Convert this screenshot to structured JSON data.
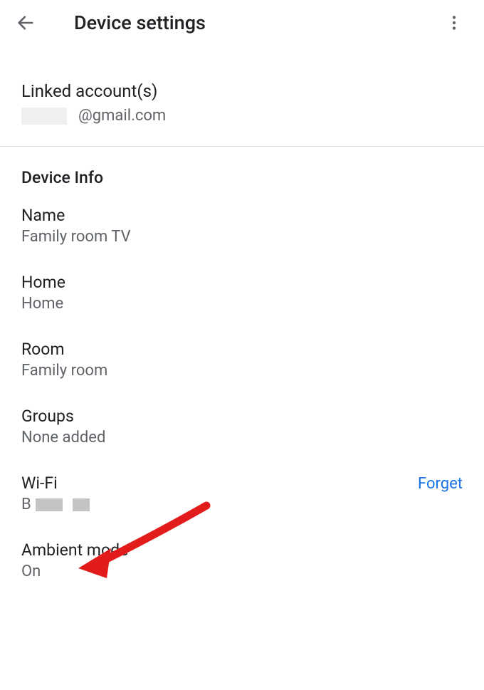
{
  "header": {
    "title": "Device settings"
  },
  "linked": {
    "title": "Linked account(s)",
    "emailSuffix": "@gmail.com"
  },
  "deviceInfo": {
    "sectionTitle": "Device Info",
    "name": {
      "label": "Name",
      "value": "Family room TV"
    },
    "home": {
      "label": "Home",
      "value": "Home"
    },
    "room": {
      "label": "Room",
      "value": "Family room"
    },
    "groups": {
      "label": "Groups",
      "value": "None added"
    },
    "wifi": {
      "label": "Wi-Fi",
      "valuePrefix": "B",
      "forget": "Forget"
    },
    "ambient": {
      "label": "Ambient mode",
      "value": "On"
    }
  }
}
